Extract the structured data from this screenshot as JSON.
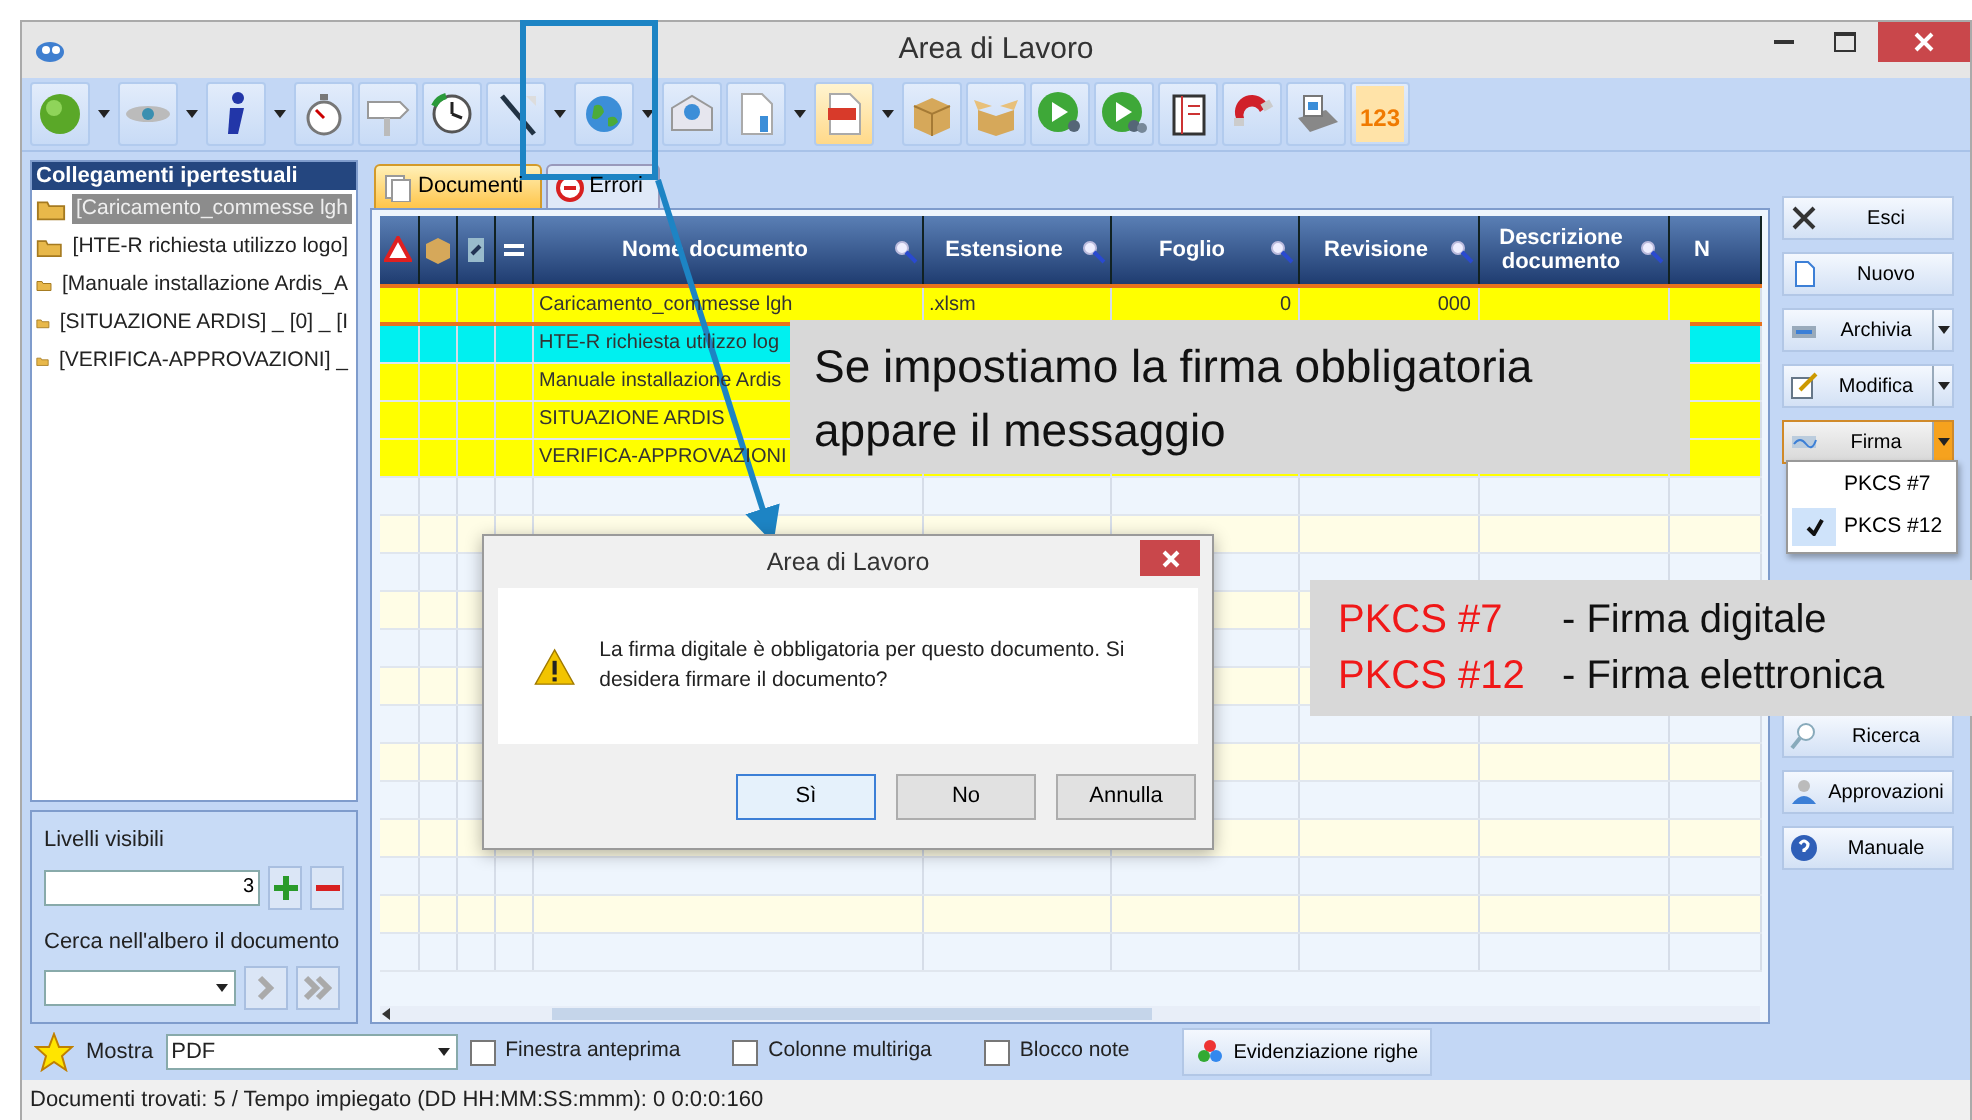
{
  "window": {
    "title": "Area di Lavoro"
  },
  "toolbar": [
    {
      "dropdown": true
    },
    {
      "dropdown": true
    },
    {
      "dropdown": true
    },
    {
      "dropdown": false
    },
    {
      "dropdown": false
    },
    {
      "dropdown": false
    },
    {
      "dropdown": true
    },
    {
      "dropdown": true
    },
    {
      "dropdown": false
    },
    {
      "dropdown": true
    },
    {
      "dropdown": true
    },
    {
      "dropdown": false
    },
    {
      "dropdown": false
    },
    {
      "dropdown": false
    },
    {
      "dropdown": false
    },
    {
      "dropdown": false
    },
    {
      "dropdown": false
    },
    {
      "dropdown": false
    },
    {
      "dropdown": false,
      "label": "123"
    }
  ],
  "links_panel": {
    "title": "Collegamenti ipertestuali",
    "items": [
      {
        "label": "[Caricamento_commesse  lgh",
        "selected": true
      },
      {
        "label": "[HTE-R  richiesta utilizzo logo]",
        "selected": false
      },
      {
        "label": "[Manuale installazione Ardis_A",
        "selected": false
      },
      {
        "label": "[SITUAZIONE ARDIS] _ [0] _ [I",
        "selected": false
      },
      {
        "label": "[VERIFICA-APPROVAZIONI] _",
        "selected": false
      }
    ]
  },
  "levels": {
    "label": "Livelli visibili",
    "value": "3",
    "search_label": "Cerca nell'albero il documento"
  },
  "tabs": [
    {
      "label": "Documenti",
      "selected": true
    },
    {
      "label": "Errori",
      "selected": false
    }
  ],
  "table": {
    "columns": [
      "Nome documento",
      "Estensione",
      "Foglio",
      "Revisione",
      "Descrizione documento",
      "N"
    ],
    "rows": [
      {
        "cells": [
          "Caricamento_commesse   lgh",
          ".xlsm",
          "0",
          "000",
          "",
          ""
        ],
        "color": "#ffff00",
        "selected": true
      },
      {
        "cells": [
          "HTE-R  richiesta utilizzo log",
          "",
          "",
          "",
          "",
          ""
        ],
        "color": "#00f0f0",
        "selected": false
      },
      {
        "cells": [
          "Manuale installazione Ardis",
          "",
          "",
          "",
          "",
          ""
        ],
        "color": "#ffff00",
        "selected": false
      },
      {
        "cells": [
          "SITUAZIONE ARDIS",
          "",
          "",
          "",
          "",
          ""
        ],
        "color": "#ffff00",
        "selected": false
      },
      {
        "cells": [
          "VERIFICA-APPROVAZIONI",
          "",
          "",
          "",
          "",
          ""
        ],
        "color": "#ffff00",
        "selected": false
      }
    ]
  },
  "side_buttons_top": [
    {
      "label": "Esci",
      "dropdown": false,
      "active": false
    },
    {
      "label": "Nuovo",
      "dropdown": false,
      "active": false
    },
    {
      "label": "Archivia",
      "dropdown": true,
      "active": false
    },
    {
      "label": "Modifica",
      "dropdown": true,
      "active": false
    },
    {
      "label": "Firma",
      "dropdown": true,
      "active": true
    }
  ],
  "side_buttons_bottom": [
    {
      "label": "Ricerca",
      "dropdown": false,
      "active": false
    },
    {
      "label": "Approvazioni",
      "dropdown": false,
      "active": false
    },
    {
      "label": "Manuale",
      "dropdown": false,
      "active": false
    }
  ],
  "firma_menu": [
    {
      "label": "PKCS #7",
      "checked": false
    },
    {
      "label": "PKCS #12",
      "checked": true
    }
  ],
  "bottom_bar": {
    "show_label": "Mostra",
    "format": "PDF",
    "options": [
      {
        "label": "Finestra anteprima",
        "checked": false
      },
      {
        "label": "Colonne multiriga",
        "checked": false
      },
      {
        "label": "Blocco note",
        "checked": false
      }
    ],
    "highlight_button": "Evidenziazione righe"
  },
  "status_bar": "Documenti trovati: 5 / Tempo impiegato (DD HH:MM:SS:mmm):  0 0:0:0:160",
  "dialog": {
    "title": "Area di Lavoro",
    "message": "La firma digitale è obbligatoria per questo documento. Si desidera firmare il documento?",
    "buttons": [
      {
        "label": "Sì",
        "selected": true
      },
      {
        "label": "No",
        "selected": false
      },
      {
        "label": "Annulla",
        "selected": false
      }
    ]
  },
  "callout_message": {
    "lines": [
      "Se impostiamo la firma obbligatoria",
      "appare il messaggio"
    ]
  },
  "callout_formats": {
    "lines": [
      {
        "code": "PKCS #7",
        "text": "- Firma digitale"
      },
      {
        "code": "PKCS #12",
        "text": "- Firma elettronica"
      }
    ]
  }
}
